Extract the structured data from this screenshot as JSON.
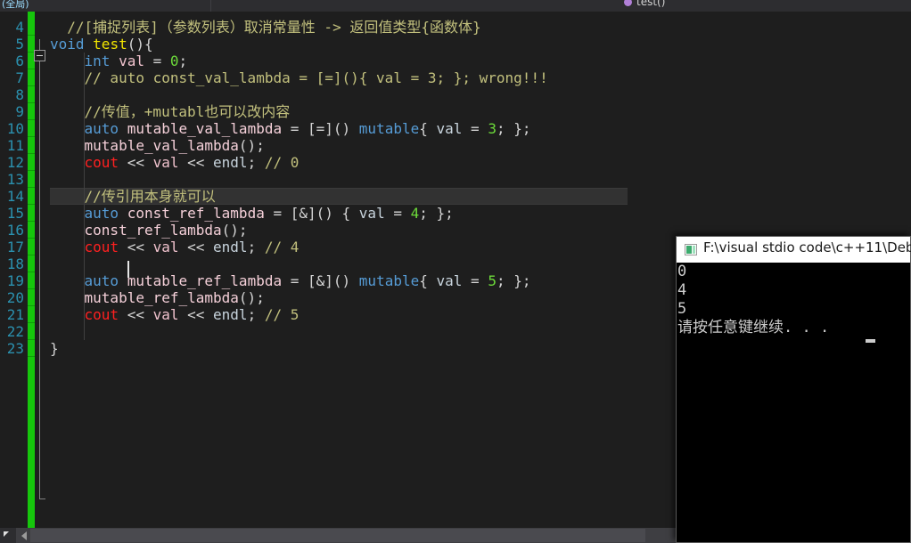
{
  "navbar": {
    "left_breadcrumb": "(全局)",
    "right_breadcrumb": "test()",
    "member_icon": "method-icon"
  },
  "editor": {
    "first_line_number": 4,
    "current_line": 14,
    "lines": [
      {
        "n": 4,
        "tokens": [
          {
            "t": "  //[捕捉列表]（参数列表）取消常量性 -> 返回值类型{函数体}",
            "c": "cmt"
          }
        ]
      },
      {
        "n": 5,
        "tokens": [
          {
            "t": "void ",
            "c": "kw"
          },
          {
            "t": "test",
            "c": "fn"
          },
          {
            "t": "(){",
            "c": "pun"
          }
        ]
      },
      {
        "n": 6,
        "tokens": [
          {
            "t": "    ",
            "c": "pun"
          },
          {
            "t": "int",
            "c": "kw"
          },
          {
            "t": " ",
            "c": "pun"
          },
          {
            "t": "val",
            "c": "var"
          },
          {
            "t": " = ",
            "c": "op"
          },
          {
            "t": "0",
            "c": "num"
          },
          {
            "t": ";",
            "c": "pun"
          }
        ]
      },
      {
        "n": 7,
        "tokens": [
          {
            "t": "    // auto const_val_lambda = [=](){ val = 3; }; wrong!!!",
            "c": "cmt"
          }
        ]
      },
      {
        "n": 8,
        "tokens": []
      },
      {
        "n": 9,
        "tokens": [
          {
            "t": "    //传值，+mutabl也可以改内容",
            "c": "cmt"
          }
        ]
      },
      {
        "n": 10,
        "tokens": [
          {
            "t": "    ",
            "c": "pun"
          },
          {
            "t": "auto",
            "c": "kw"
          },
          {
            "t": " ",
            "c": "pun"
          },
          {
            "t": "mutable_val_lambda",
            "c": "id"
          },
          {
            "t": " = [=]() ",
            "c": "op"
          },
          {
            "t": "mutable",
            "c": "kw"
          },
          {
            "t": "{ ",
            "c": "pun"
          },
          {
            "t": "val",
            "c": "endl"
          },
          {
            "t": " = ",
            "c": "op"
          },
          {
            "t": "3",
            "c": "num"
          },
          {
            "t": "; };",
            "c": "pun"
          }
        ]
      },
      {
        "n": 11,
        "tokens": [
          {
            "t": "    ",
            "c": "pun"
          },
          {
            "t": "mutable_val_lambda",
            "c": "id"
          },
          {
            "t": "();",
            "c": "pun"
          }
        ]
      },
      {
        "n": 12,
        "tokens": [
          {
            "t": "    ",
            "c": "pun"
          },
          {
            "t": "cout",
            "c": "cout"
          },
          {
            "t": " << ",
            "c": "op"
          },
          {
            "t": "val",
            "c": "var"
          },
          {
            "t": " << ",
            "c": "op"
          },
          {
            "t": "endl",
            "c": "endl"
          },
          {
            "t": "; ",
            "c": "pun"
          },
          {
            "t": "// 0",
            "c": "cmt"
          }
        ]
      },
      {
        "n": 13,
        "tokens": []
      },
      {
        "n": 14,
        "tokens": [
          {
            "t": "    //传引用本身就可以",
            "c": "cmt"
          }
        ]
      },
      {
        "n": 15,
        "tokens": [
          {
            "t": "    ",
            "c": "pun"
          },
          {
            "t": "auto",
            "c": "kw"
          },
          {
            "t": " ",
            "c": "pun"
          },
          {
            "t": "const_ref_lambda",
            "c": "id"
          },
          {
            "t": " = [&]() { ",
            "c": "op"
          },
          {
            "t": "val",
            "c": "endl"
          },
          {
            "t": " = ",
            "c": "op"
          },
          {
            "t": "4",
            "c": "num"
          },
          {
            "t": "; };",
            "c": "pun"
          }
        ]
      },
      {
        "n": 16,
        "tokens": [
          {
            "t": "    ",
            "c": "pun"
          },
          {
            "t": "const_ref_lambda",
            "c": "id"
          },
          {
            "t": "();",
            "c": "pun"
          }
        ]
      },
      {
        "n": 17,
        "tokens": [
          {
            "t": "    ",
            "c": "pun"
          },
          {
            "t": "cout",
            "c": "cout"
          },
          {
            "t": " << ",
            "c": "op"
          },
          {
            "t": "val",
            "c": "var"
          },
          {
            "t": " << ",
            "c": "op"
          },
          {
            "t": "endl",
            "c": "endl"
          },
          {
            "t": "; ",
            "c": "pun"
          },
          {
            "t": "// 4",
            "c": "cmt"
          }
        ]
      },
      {
        "n": 18,
        "tokens": []
      },
      {
        "n": 19,
        "tokens": [
          {
            "t": "    ",
            "c": "pun"
          },
          {
            "t": "auto",
            "c": "kw"
          },
          {
            "t": " ",
            "c": "pun"
          },
          {
            "t": "mutable_ref_lambda",
            "c": "id"
          },
          {
            "t": " = [&]() ",
            "c": "op"
          },
          {
            "t": "mutable",
            "c": "kw"
          },
          {
            "t": "{ ",
            "c": "pun"
          },
          {
            "t": "val",
            "c": "endl"
          },
          {
            "t": " = ",
            "c": "op"
          },
          {
            "t": "5",
            "c": "num"
          },
          {
            "t": "; };",
            "c": "pun"
          }
        ]
      },
      {
        "n": 20,
        "tokens": [
          {
            "t": "    ",
            "c": "pun"
          },
          {
            "t": "mutable_ref_lambda",
            "c": "id"
          },
          {
            "t": "();",
            "c": "pun"
          }
        ]
      },
      {
        "n": 21,
        "tokens": [
          {
            "t": "    ",
            "c": "pun"
          },
          {
            "t": "cout",
            "c": "cout"
          },
          {
            "t": " << ",
            "c": "op"
          },
          {
            "t": "val",
            "c": "var"
          },
          {
            "t": " << ",
            "c": "op"
          },
          {
            "t": "endl",
            "c": "endl"
          },
          {
            "t": "; ",
            "c": "pun"
          },
          {
            "t": "// 5",
            "c": "cmt"
          }
        ]
      },
      {
        "n": 22,
        "tokens": []
      },
      {
        "n": 23,
        "tokens": [
          {
            "t": "}",
            "c": "pun"
          }
        ]
      }
    ]
  },
  "console": {
    "title": "F:\\visual stdio code\\c++11\\Deb",
    "icon": "console-window-icon",
    "output": [
      "0",
      "4",
      "5",
      "请按任意键继续. . ."
    ]
  },
  "colors": {
    "editor_background": "#1e1e1e",
    "line_number": "#2b91af",
    "change_bar": "#16c60c",
    "comment": "#c2c07d",
    "keyword": "#569cd6",
    "function_name": "#f2e500",
    "number": "#6ddb3a",
    "cout": "#ff2020",
    "variable": "#f0c2cd",
    "current_line_highlight": "#323232",
    "console_background": "#000000",
    "console_titlebar": "#ffffff"
  }
}
